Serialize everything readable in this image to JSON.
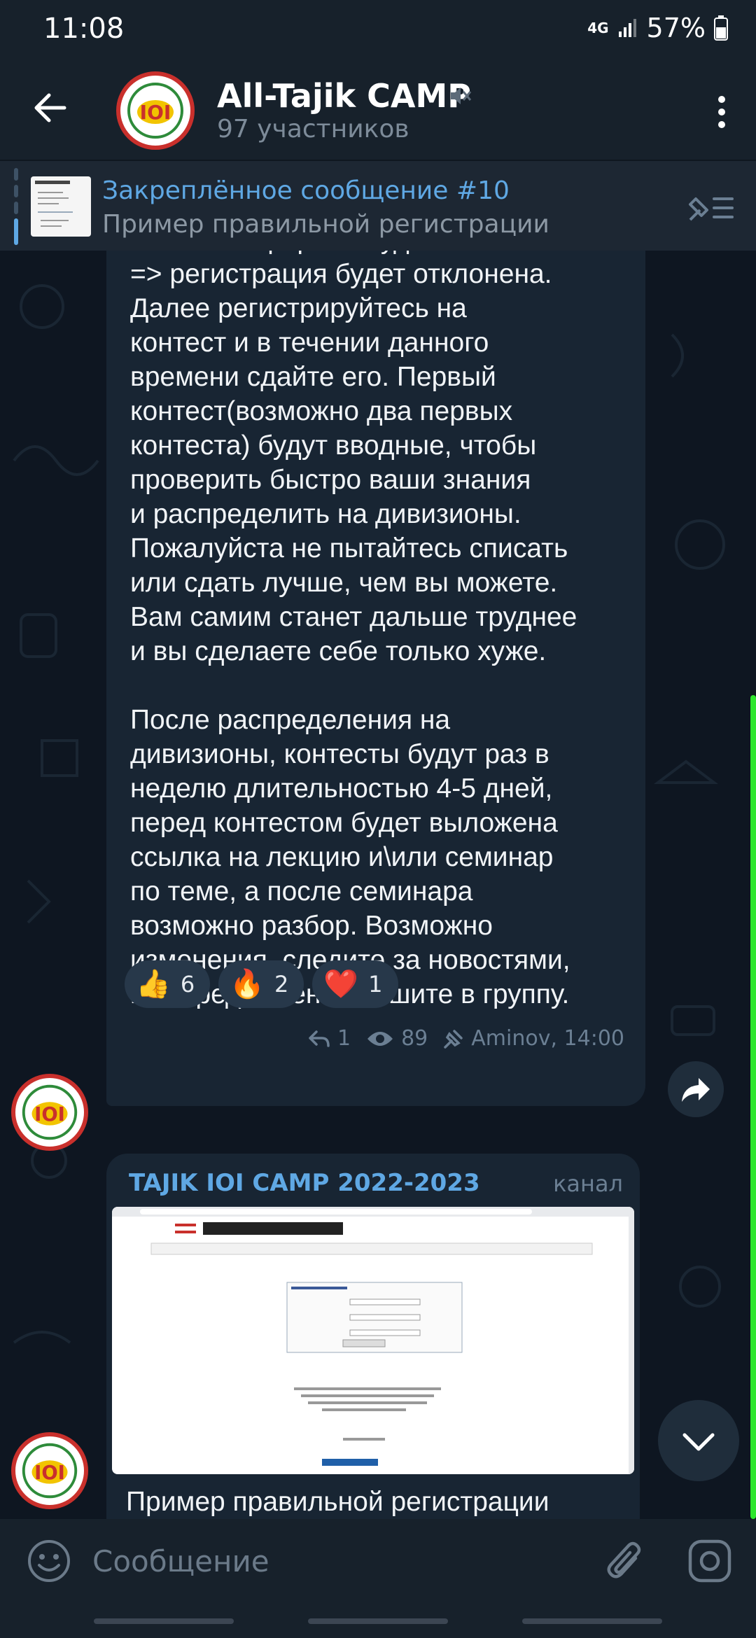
{
  "status": {
    "time": "11:08",
    "network": "4G",
    "battery": "57%"
  },
  "header": {
    "title": "All-Tajik CAMP",
    "subtitle": "97 участников"
  },
  "pinned": {
    "title": "Закреплённое сообщение #10",
    "text": "Пример правильной регистрации"
  },
  "message": {
    "paragraphs": [
      "Если ваш формат будет отличаться\n=> регистрация будет отклонена.\nДалее регистрируйтесь на\nконтест и в течении данного\nвремени сдайте его. Первый\nконтест(возможно два первых\nконтеста) будут вводные, чтобы\nпроверить быстро ваши знания\nи распределить на дивизионы.\nПожалуйста не пытайтесь списать\nили сдать лучше, чем вы можете.\nВам самим станет дальше труднее\nи вы сделаете себе только хуже.",
      "После распределения на\nдивизионы, контесты будут раз в\nнеделю длительностью 4-5 дней,\nперед контестом будет выложена\nссылка на лекцию и\\или семинар\nпо теме, а после семинара\nвозможно разбор. Возможно\nизменения, следите за новостями,\nвсе предложения пишите в группу."
    ],
    "reactions": [
      {
        "emoji": "👍",
        "count": "6"
      },
      {
        "emoji": "🔥",
        "count": "2"
      },
      {
        "emoji": "❤️",
        "count": "1"
      }
    ],
    "replies": "1",
    "views": "89",
    "author_time": "Aminov, 14:00"
  },
  "forwarded": {
    "channel": "TAJIK IOI CAMP 2022-2023",
    "tag": "канал",
    "caption": "Пример правильной регистрации"
  },
  "composer": {
    "placeholder": "Сообщение"
  },
  "colors": {
    "accent": "#5fa8e4",
    "bubble": "#182533",
    "background": "#0e1621",
    "scrollbar": "#2ee62e"
  }
}
